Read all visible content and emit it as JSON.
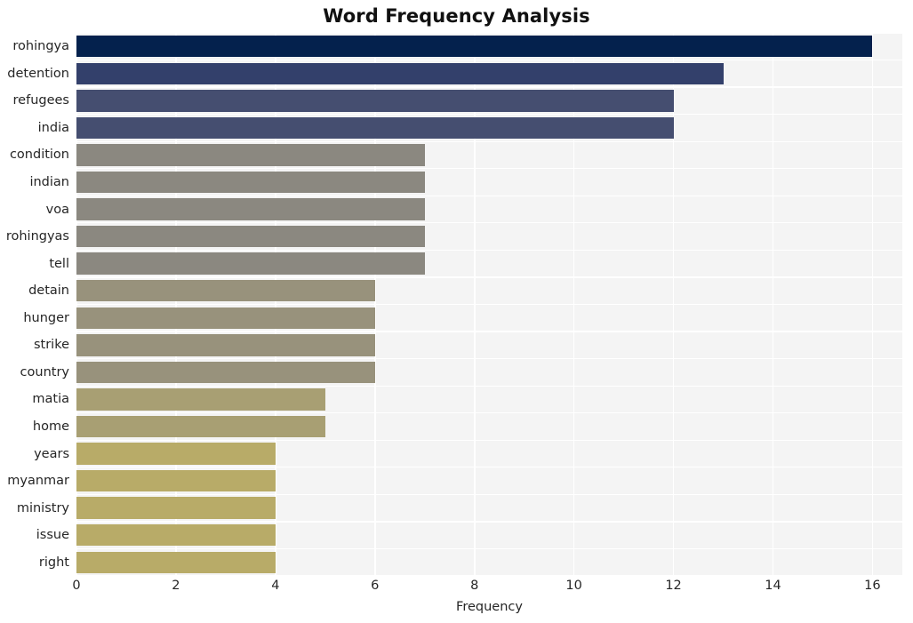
{
  "chart_data": {
    "type": "bar",
    "orientation": "horizontal",
    "title": "Word Frequency Analysis",
    "xlabel": "Frequency",
    "ylabel": "",
    "categories": [
      "rohingya",
      "detention",
      "refugees",
      "india",
      "condition",
      "indian",
      "voa",
      "rohingyas",
      "tell",
      "detain",
      "hunger",
      "strike",
      "country",
      "matia",
      "home",
      "years",
      "myanmar",
      "ministry",
      "issue",
      "right"
    ],
    "values": [
      16,
      13,
      12,
      12,
      7,
      7,
      7,
      7,
      7,
      6,
      6,
      6,
      6,
      5,
      5,
      4,
      4,
      4,
      4,
      4
    ],
    "bar_colors": [
      "#04214d",
      "#33406b",
      "#454e70",
      "#454e70",
      "#8b8880",
      "#8b8880",
      "#8b8880",
      "#8b8880",
      "#8b8880",
      "#98927c",
      "#98927c",
      "#98927c",
      "#98927c",
      "#a89f73",
      "#a89f73",
      "#b8ab68",
      "#b8ab68",
      "#b8ab68",
      "#b8ab68",
      "#b8ab68"
    ],
    "xlim": [
      0,
      16.6
    ],
    "xticks": [
      0,
      2,
      4,
      6,
      8,
      10,
      12,
      14,
      16
    ],
    "xtick_labels": [
      "0",
      "2",
      "4",
      "6",
      "8",
      "10",
      "12",
      "14",
      "16"
    ],
    "grid": true,
    "grid_color": "#ffffff",
    "plot_background": "#f4f4f4",
    "figure_background": "#ffffff",
    "legend": null
  }
}
